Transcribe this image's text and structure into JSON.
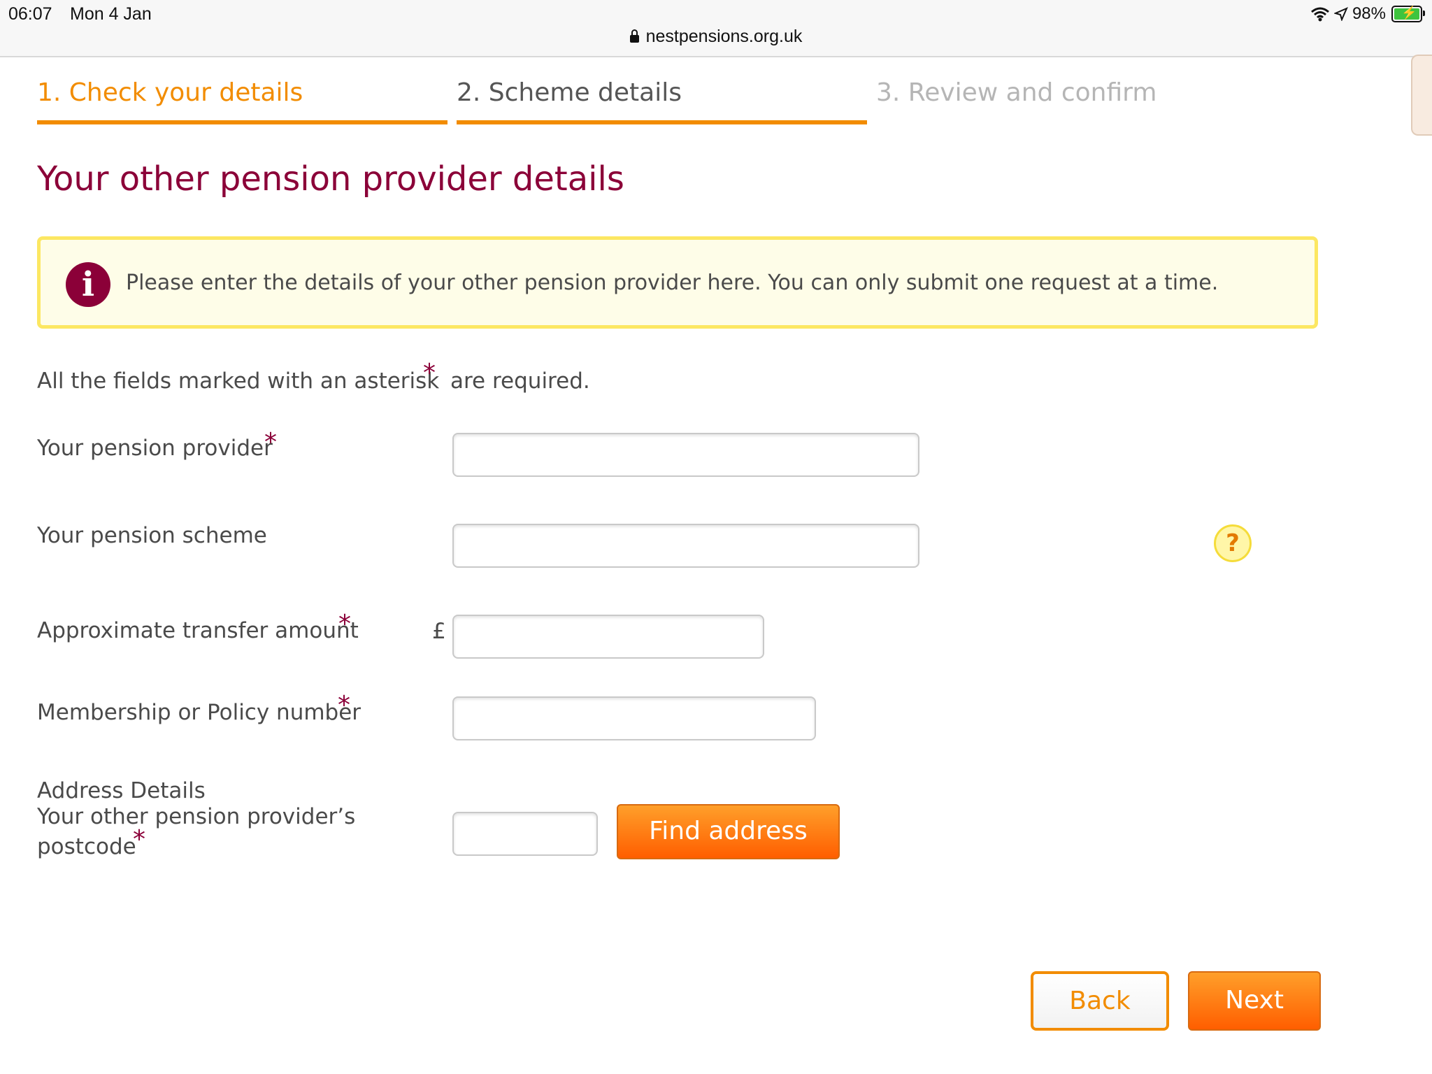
{
  "status_bar": {
    "time": "06:07",
    "date": "Mon 4 Jan",
    "url": "nestpensions.org.uk",
    "battery": "98%"
  },
  "steps": [
    {
      "label": "1. Check your details",
      "state": "complete"
    },
    {
      "label": "2. Scheme details",
      "state": "current"
    },
    {
      "label": "3. Review and confirm",
      "state": "upcoming"
    }
  ],
  "page_title": "Your other pension provider details",
  "info_message": "Please enter the details of your other pension provider here. You can only submit one request at a time.",
  "required_note": {
    "prefix": "All the fields marked with an asterisk",
    "asterisk": "*",
    "suffix": "are required."
  },
  "form": {
    "provider_label": "Your pension provider",
    "provider_value": "",
    "scheme_label": "Your pension scheme",
    "scheme_value": "",
    "help_symbol": "?",
    "amount_label": "Approximate transfer amount",
    "currency_symbol": "£",
    "amount_value": "",
    "policy_label": "Membership or Policy number",
    "policy_value": "",
    "address_heading": "Address Details",
    "postcode_label_line1": "Your other pension provider’s",
    "postcode_label_line2": "postcode",
    "postcode_value": "",
    "find_address_label": "Find address"
  },
  "nav": {
    "back_label": "Back",
    "next_label": "Next"
  },
  "colors": {
    "accent_orange": "#f28c00",
    "brand_burgundy": "#8b0038",
    "info_border": "#fce762"
  }
}
